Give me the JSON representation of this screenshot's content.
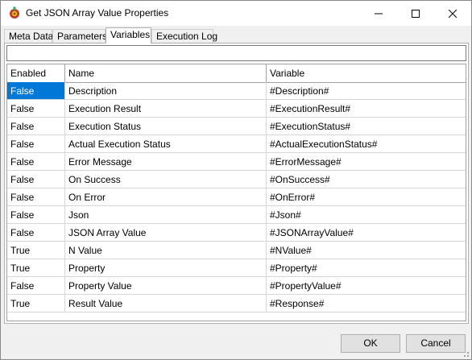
{
  "window": {
    "title": "Get JSON Array Value Properties",
    "icons": {
      "app": "gear-app-icon",
      "minimize": "minimize-icon",
      "maximize": "maximize-icon",
      "close": "close-icon"
    }
  },
  "tabs": [
    {
      "label": "Meta Data",
      "active": false
    },
    {
      "label": "Parameters",
      "active": false
    },
    {
      "label": "Variables",
      "active": true
    },
    {
      "label": "Execution Log",
      "active": false
    }
  ],
  "filter": {
    "value": ""
  },
  "grid": {
    "columns": [
      "Enabled",
      "Name",
      "Variable"
    ],
    "selected_row": 0,
    "rows": [
      {
        "enabled": "False",
        "name": "Description",
        "variable": "#Description#"
      },
      {
        "enabled": "False",
        "name": "Execution Result",
        "variable": "#ExecutionResult#"
      },
      {
        "enabled": "False",
        "name": "Execution Status",
        "variable": "#ExecutionStatus#"
      },
      {
        "enabled": "False",
        "name": "Actual Execution Status",
        "variable": "#ActualExecutionStatus#"
      },
      {
        "enabled": "False",
        "name": "Error Message",
        "variable": "#ErrorMessage#"
      },
      {
        "enabled": "False",
        "name": "On Success",
        "variable": "#OnSuccess#"
      },
      {
        "enabled": "False",
        "name": "On Error",
        "variable": "#OnError#"
      },
      {
        "enabled": "False",
        "name": "Json",
        "variable": "#Json#"
      },
      {
        "enabled": "False",
        "name": "JSON Array Value",
        "variable": "#JSONArrayValue#"
      },
      {
        "enabled": "True",
        "name": "N Value",
        "variable": "#NValue#"
      },
      {
        "enabled": "True",
        "name": "Property",
        "variable": "#Property#"
      },
      {
        "enabled": "False",
        "name": "Property Value",
        "variable": "#PropertyValue#"
      },
      {
        "enabled": "True",
        "name": "Result Value",
        "variable": "#Response#"
      }
    ]
  },
  "buttons": {
    "ok": "OK",
    "cancel": "Cancel"
  },
  "colors": {
    "selection": "#0078d7"
  }
}
